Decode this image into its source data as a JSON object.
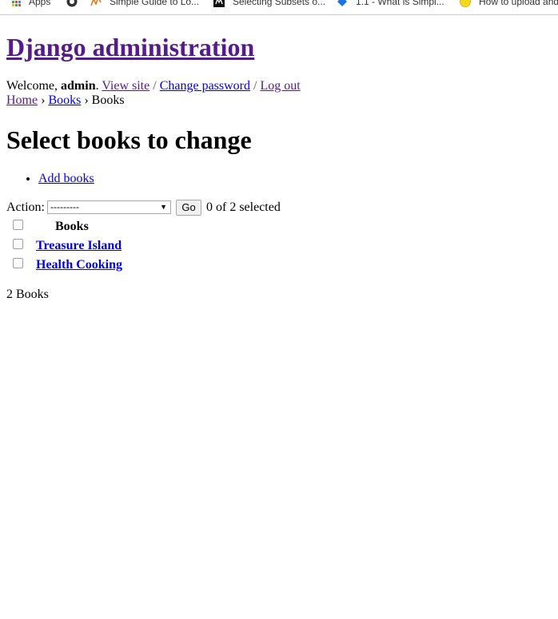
{
  "bookmarks": [
    {
      "label": "Apps",
      "icon": "apps-grid-icon"
    },
    {
      "label": "",
      "icon": "github-icon"
    },
    {
      "label": "Simple Guide to Lo...",
      "icon": "chart-line-icon"
    },
    {
      "label": "Selecting Subsets o...",
      "icon": "mode-logo-icon"
    },
    {
      "label": "1.1 - What is Simpl...",
      "icon": "shield-icon"
    },
    {
      "label": "How to upload and...",
      "icon": "smiley-icon"
    }
  ],
  "header": {
    "site_title": "Django administration",
    "welcome_prefix": "Welcome,",
    "username": "admin",
    "view_site": "View site",
    "change_password": "Change password",
    "log_out": "Log out",
    "separator": "/"
  },
  "breadcrumbs": {
    "home": "Home",
    "app": "Books",
    "current": "Books",
    "separator": "›"
  },
  "content": {
    "title": "Select books to change",
    "add_link": "Add books"
  },
  "actions": {
    "label": "Action:",
    "selected_option": "---------",
    "go_label": "Go",
    "counter": "0 of 2 selected"
  },
  "results": {
    "column_header": "Books",
    "rows": [
      {
        "title": "Treasure Island"
      },
      {
        "title": "Health Cooking"
      }
    ]
  },
  "paginator": {
    "text": "2 Books"
  },
  "colors": {
    "link": "#0000ee",
    "visited_link": "#551a8b"
  }
}
